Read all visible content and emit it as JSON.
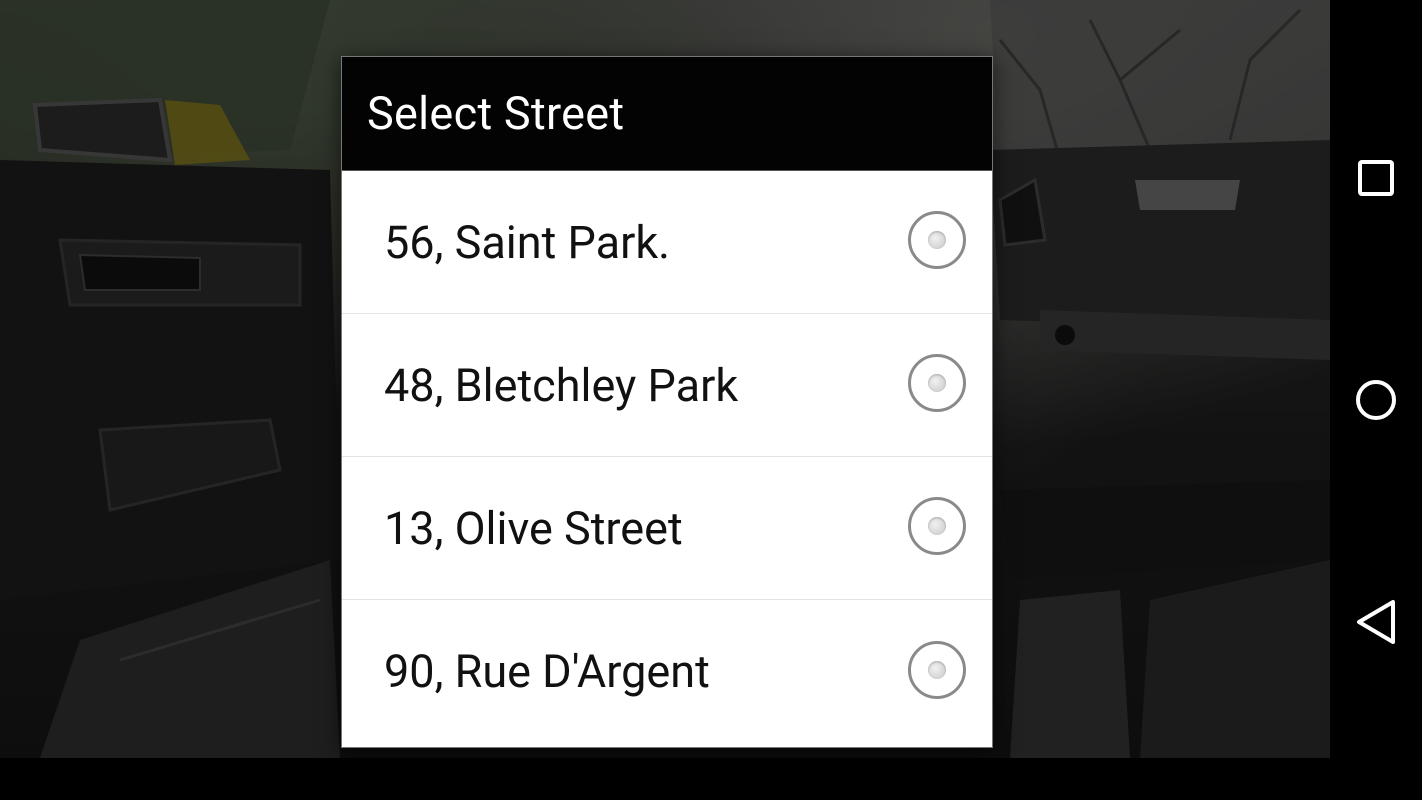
{
  "dialog": {
    "title": "Select Street",
    "options": [
      {
        "label": "56, Saint Park.",
        "selected": false
      },
      {
        "label": "48, Bletchley Park",
        "selected": false
      },
      {
        "label": "13, Olive Street",
        "selected": false
      },
      {
        "label": "90, Rue D'Argent",
        "selected": false
      }
    ]
  },
  "background": {
    "description_icon": "car-interior-photo"
  },
  "nav_bar": {
    "recents_icon": "square-icon",
    "home_icon": "circle-icon",
    "back_icon": "triangle-back-icon"
  },
  "colors": {
    "title_bar": "#030303",
    "title_text": "#ffffff",
    "option_text": "#111111",
    "radio_border": "#8a8a8a"
  }
}
